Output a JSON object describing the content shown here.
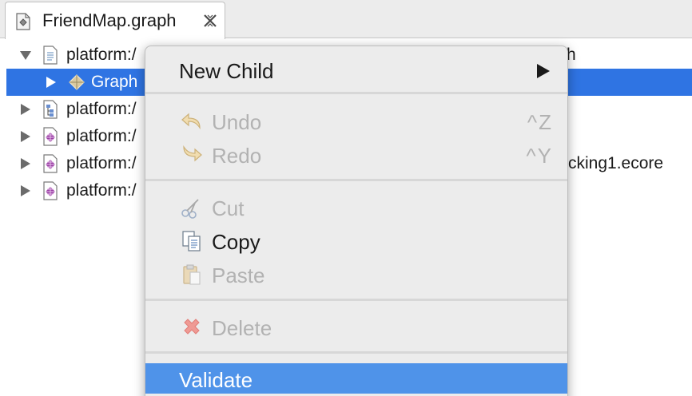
{
  "tab": {
    "title": "FriendMap.graph",
    "icon": "graph-file-icon"
  },
  "tree": {
    "rows": [
      {
        "label": "platform:/",
        "suffix": "h",
        "icon": "resource-file-icon",
        "expanded": true
      },
      {
        "label": "Graph",
        "icon": "graph-node-icon",
        "selected": true
      },
      {
        "label": "platform:/",
        "icon": "model-tree-icon"
      },
      {
        "label": "platform:/",
        "icon": "ecore-file-icon"
      },
      {
        "label": "platform:/",
        "suffix": "cking1.ecore",
        "icon": "ecore-file-icon"
      },
      {
        "label": "platform:/",
        "icon": "ecore-file-icon"
      }
    ]
  },
  "context_menu": {
    "new_child": {
      "label": "New Child",
      "has_submenu": true
    },
    "undo": {
      "label": "Undo",
      "shortcut": "^Z",
      "enabled": false
    },
    "redo": {
      "label": "Redo",
      "shortcut": "^Y",
      "enabled": false
    },
    "cut": {
      "label": "Cut",
      "enabled": false
    },
    "copy": {
      "label": "Copy",
      "enabled": true
    },
    "paste": {
      "label": "Paste",
      "enabled": false
    },
    "delete": {
      "label": "Delete",
      "enabled": false
    },
    "validate": {
      "label": "Validate",
      "highlighted": true
    }
  },
  "colors": {
    "selection": "#2f74e3",
    "menu_highlight": "#4f93e9",
    "menu_bg": "#ececec",
    "disabled_text": "#b2b2b2"
  }
}
